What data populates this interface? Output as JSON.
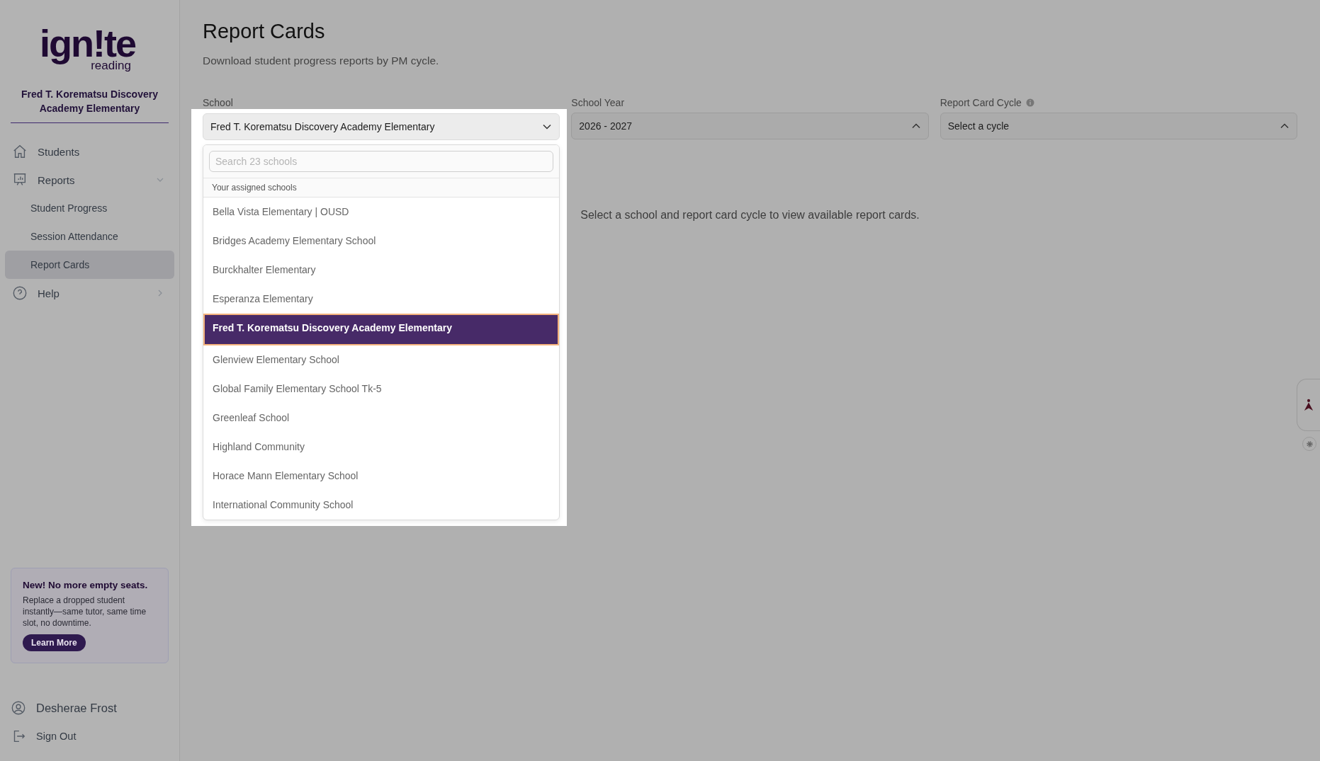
{
  "sidebar": {
    "logo": {
      "word": "ign!te",
      "tagline": "reading"
    },
    "org_name": "Fred T. Korematsu Discovery Academy Elementary",
    "nav": [
      {
        "label": "Students",
        "kind": "home",
        "selected": false
      },
      {
        "label": "Reports",
        "kind": "chart",
        "selected": false,
        "expanded": true,
        "children": [
          {
            "label": "Student Progress",
            "selected": false
          },
          {
            "label": "Session Attendance",
            "selected": false
          },
          {
            "label": "Report Cards",
            "selected": true
          }
        ]
      },
      {
        "label": "Help",
        "kind": "help",
        "selected": false,
        "expanded": false
      }
    ],
    "promo": {
      "title": "New! No more empty seats.",
      "text": "Replace a dropped student instantly—same tutor, same time slot, no downtime.",
      "button": "Learn More"
    },
    "user": {
      "name": "Desherae Frost"
    },
    "sign_out": "Sign Out"
  },
  "page": {
    "title": "Report Cards",
    "subtitle": "Download student progress reports by PM cycle."
  },
  "filters": [
    {
      "label": "School",
      "value": "Fred T. Korematsu Discovery Academy Elementary",
      "expanded": false,
      "focused": true
    },
    {
      "label": "School Year",
      "value": "2026 - 2027",
      "expanded": true,
      "focused": false
    },
    {
      "label": "Report Card Cycle",
      "value": "Select a cycle",
      "expanded": true,
      "info": true,
      "focused": false
    }
  ],
  "dropdown": {
    "search_placeholder": "Search 23 schools",
    "group_label": "Your assigned schools",
    "options": [
      {
        "label": "Bella Vista Elementary | OUSD",
        "selected": false
      },
      {
        "label": "Bridges Academy Elementary School",
        "selected": false
      },
      {
        "label": "Burckhalter Elementary",
        "selected": false
      },
      {
        "label": "Esperanza Elementary",
        "selected": false
      },
      {
        "label": "Fred T. Korematsu Discovery Academy Elementary",
        "selected": true
      },
      {
        "label": "Glenview Elementary School",
        "selected": false
      },
      {
        "label": "Global Family Elementary School Tk-5",
        "selected": false
      },
      {
        "label": "Greenleaf School",
        "selected": false
      },
      {
        "label": "Highland Community",
        "selected": false
      },
      {
        "label": "Horace Mann Elementary School",
        "selected": false
      },
      {
        "label": "International Community School",
        "selected": false
      }
    ]
  },
  "empty_message": "Select a school and report card cycle to view available report cards."
}
